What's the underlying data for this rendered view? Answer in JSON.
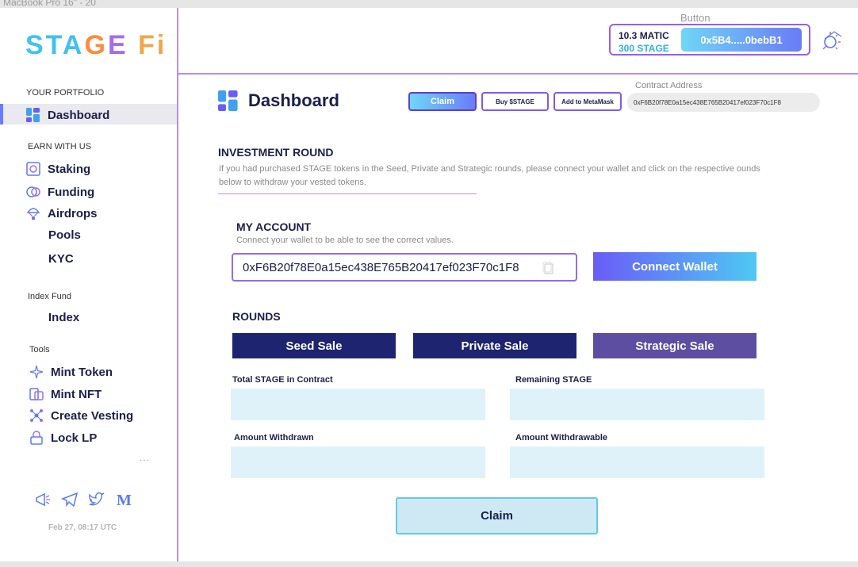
{
  "frame": {
    "label": "MacBook Pro 16\" - 20"
  },
  "logo": {
    "part1": "STA",
    "part2": "G",
    "part3": "E",
    "part4": "Fi"
  },
  "sidebar": {
    "portfolio_header": "YOUR PORTFOLIO",
    "dashboard": "Dashboard",
    "earn_header": "EARN WITH US",
    "staking": "Staking",
    "funding": "Funding",
    "airdrops": "Airdrops",
    "pools": "Pools",
    "kyc": "KYC",
    "index_header": "Index Fund",
    "index": "Index",
    "tools_header": "Tools",
    "mint_token": "Mint Token",
    "mint_nft": "Mint NFT",
    "create_vesting": "Create Vesting",
    "lock_lp": "Lock LP",
    "more": "...",
    "socials": [
      "megaphone-icon",
      "telegram-icon",
      "twitter-icon",
      "medium-icon"
    ],
    "date": "Feb 27, 08:17 UTC"
  },
  "header": {
    "button_caption": "Button",
    "matic": "10.3 MATIC",
    "stage": "300 STAGE",
    "address": "0x5B4.....0bebB1"
  },
  "dashboard": {
    "title": "Dashboard",
    "claim_pill": "Claim",
    "buy_pill": "Buy $STAGE",
    "metamask_pill": "Add to MetaMask",
    "contract_label": "Contract Address",
    "contract_value": "0xF6B20f78E0a15ec438E765B20417ef023F70c1F8"
  },
  "investment": {
    "title": "INVESTMENT ROUND",
    "desc": "If you had purchased STAGE tokens in the Seed, Private and Strategic rounds, please connect your wallet and click on the respective ounds below to withdraw your vested tokens."
  },
  "account": {
    "title": "MY ACCOUNT",
    "desc": "Connect your wallet to be able to see the correct values.",
    "address": "0xF6B20f78E0a15ec438E765B20417ef023F70c1F8",
    "connect": "Connect Wallet"
  },
  "rounds": {
    "title": "ROUNDS",
    "seed": "Seed Sale",
    "private": "Private Sale",
    "strategic": "Strategic Sale"
  },
  "fields": {
    "total": "Total STAGE in Contract",
    "remaining": "Remaining STAGE",
    "withdrawn": "Amount Withdrawn",
    "withdrawable": "Amount Withdrawable"
  },
  "claim_button": "Claim",
  "colors": {
    "accent": "#6a7cf6",
    "navy": "#1e2470",
    "purple": "#5e4ea2",
    "field": "#e0f2f9"
  }
}
